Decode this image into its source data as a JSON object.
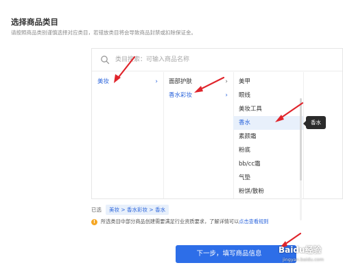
{
  "header": {
    "title": "选择商品类目",
    "description": "请按照商品类别谨慎选择对应类目，若错放类目将会导致商品封禁或扣除保证金。"
  },
  "search": {
    "placeholder": "类目搜索：可输入商品名称"
  },
  "columns": {
    "level1": [
      {
        "label": "美妆",
        "active": true
      }
    ],
    "level2": [
      {
        "label": "面部护肤",
        "active": false
      },
      {
        "label": "香水彩妆",
        "active": true
      }
    ],
    "level3": [
      {
        "label": "美甲"
      },
      {
        "label": "眼线"
      },
      {
        "label": "美妆工具"
      },
      {
        "label": "香水",
        "highlighted": true
      },
      {
        "label": "素颜霜"
      },
      {
        "label": "粉底"
      },
      {
        "label": "bb/cc霜"
      },
      {
        "label": "气垫"
      },
      {
        "label": "粉饼/散粉"
      }
    ]
  },
  "tooltip": {
    "text": "香水"
  },
  "selected": {
    "label": "已选",
    "path": "美妆 > 香水彩妆 > 香水"
  },
  "notice": {
    "text": "所选类目中部分商品创建需要满足行业资质要求，了解详情可以",
    "link": "点击查看规则"
  },
  "next_button": {
    "label": "下一步，填写商品信息"
  },
  "watermark": {
    "text": "Baidu经验",
    "sub": "jingyan.baidu.com"
  },
  "colors": {
    "accent": "#2d6ee8",
    "link": "#2d66dc",
    "arrow": "#e0242b",
    "warning": "#f5a623"
  }
}
